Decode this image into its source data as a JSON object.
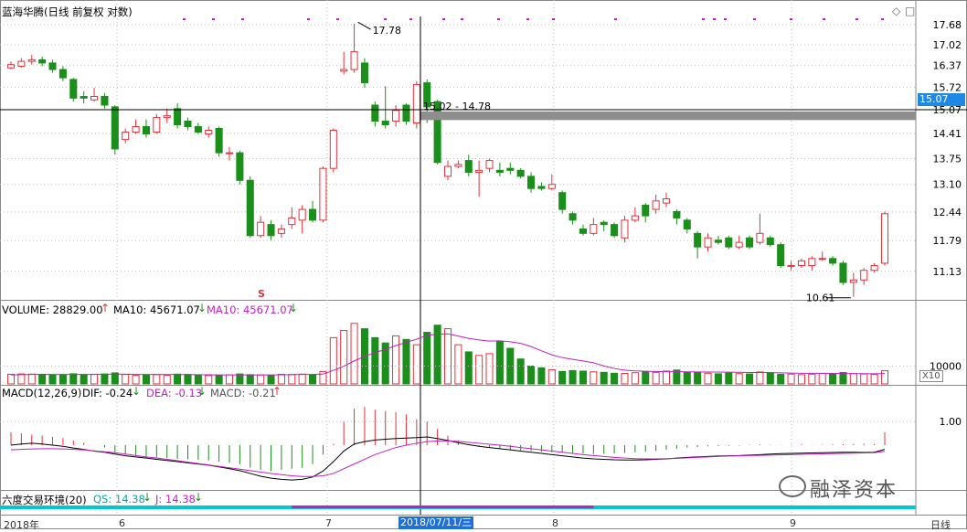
{
  "header": {
    "stock_title": "蓝海华腾(日线 前复权 对数)",
    "current_price": "15.07",
    "corner_icons": [
      "diamond-icon",
      "square-icon"
    ]
  },
  "colors": {
    "up": "#e8303a",
    "down": "#1a8f1a",
    "ma10": "#c020c0",
    "dif": "#000000",
    "dea": "#c020c0",
    "qs": "#00c8d0",
    "j": "#c020c0"
  },
  "annotations": {
    "high_label": "17.78",
    "low_label": "10.61",
    "box_label": "15.02 - 14.78",
    "marker": "S"
  },
  "volume": {
    "label": "VOLUME: 28829.00",
    "ma10_a": "MA10: 45671.07",
    "ma10_b": "MA10: 45671.07",
    "tick": "10000",
    "scale": "X10"
  },
  "macd": {
    "label": "MACD(12,26,9)",
    "dif": "DIF: -0.24",
    "dea": "DEA: -0.13",
    "macd": "MACD: -0.21",
    "tick": "1.00"
  },
  "env": {
    "label": "六度交易环境(20)",
    "qs": "QS: 14.38",
    "j": "J: 14.38"
  },
  "xaxis": {
    "year": "2018年",
    "months": [
      "6",
      "7",
      "8",
      "9"
    ],
    "crosshair_date": "2018/07/11/三",
    "period": "日线"
  },
  "watermark": "融泽资本",
  "chart_data": {
    "type": "candlestick",
    "title": "蓝海华腾(日线 前复权 对数)",
    "price_axis_ticks": [
      17.68,
      17.02,
      16.37,
      15.72,
      15.07,
      14.41,
      13.75,
      13.1,
      12.44,
      11.79,
      11.13
    ],
    "price_range": [
      10.55,
      17.95
    ],
    "candles": [
      {
        "o": 16.3,
        "c": 16.4,
        "h": 16.5,
        "l": 16.25
      },
      {
        "o": 16.35,
        "c": 16.5,
        "h": 16.6,
        "l": 16.3
      },
      {
        "o": 16.5,
        "c": 16.55,
        "h": 16.7,
        "l": 16.4
      },
      {
        "o": 16.55,
        "c": 16.45,
        "h": 16.65,
        "l": 16.35
      },
      {
        "o": 16.45,
        "c": 16.25,
        "h": 16.55,
        "l": 16.15
      },
      {
        "o": 16.25,
        "c": 16.0,
        "h": 16.35,
        "l": 15.9
      },
      {
        "o": 15.95,
        "c": 15.4,
        "h": 16.0,
        "l": 15.3
      },
      {
        "o": 15.45,
        "c": 15.4,
        "h": 15.6,
        "l": 15.25
      },
      {
        "o": 15.35,
        "c": 15.45,
        "h": 15.7,
        "l": 15.3
      },
      {
        "o": 15.45,
        "c": 15.2,
        "h": 15.55,
        "l": 15.1
      },
      {
        "o": 15.15,
        "c": 14.0,
        "h": 15.2,
        "l": 13.85
      },
      {
        "o": 14.25,
        "c": 14.45,
        "h": 14.55,
        "l": 14.15
      },
      {
        "o": 14.45,
        "c": 14.6,
        "h": 14.8,
        "l": 14.4
      },
      {
        "o": 14.6,
        "c": 14.4,
        "h": 14.8,
        "l": 14.3
      },
      {
        "o": 14.45,
        "c": 14.85,
        "h": 14.95,
        "l": 14.4
      },
      {
        "o": 14.85,
        "c": 14.9,
        "h": 15.1,
        "l": 14.7
      },
      {
        "o": 15.1,
        "c": 14.65,
        "h": 15.25,
        "l": 14.55
      },
      {
        "o": 14.75,
        "c": 14.6,
        "h": 14.85,
        "l": 14.5
      },
      {
        "o": 14.6,
        "c": 14.45,
        "h": 14.7,
        "l": 14.4
      },
      {
        "o": 14.4,
        "c": 14.5,
        "h": 14.6,
        "l": 14.3
      },
      {
        "o": 14.55,
        "c": 13.9,
        "h": 14.6,
        "l": 13.8
      },
      {
        "o": 13.9,
        "c": 13.9,
        "h": 14.05,
        "l": 13.7
      },
      {
        "o": 13.9,
        "c": 13.2,
        "h": 13.95,
        "l": 13.1
      },
      {
        "o": 13.2,
        "c": 11.9,
        "h": 13.3,
        "l": 11.85
      },
      {
        "o": 11.9,
        "c": 12.2,
        "h": 12.35,
        "l": 11.85
      },
      {
        "o": 12.15,
        "c": 11.9,
        "h": 12.25,
        "l": 11.8
      },
      {
        "o": 11.95,
        "c": 12.05,
        "h": 12.15,
        "l": 11.85
      },
      {
        "o": 12.15,
        "c": 12.3,
        "h": 12.55,
        "l": 12.05
      },
      {
        "o": 12.25,
        "c": 12.5,
        "h": 12.6,
        "l": 11.95
      },
      {
        "o": 12.5,
        "c": 12.25,
        "h": 12.7,
        "l": 12.2
      },
      {
        "o": 12.25,
        "c": 13.5,
        "h": 13.55,
        "l": 12.2
      },
      {
        "o": 13.5,
        "c": 14.5,
        "h": 14.55,
        "l": 13.4
      },
      {
        "o": 16.2,
        "c": 16.25,
        "h": 16.8,
        "l": 16.1
      },
      {
        "o": 16.25,
        "c": 16.8,
        "h": 17.7,
        "l": 16.15
      },
      {
        "o": 16.45,
        "c": 15.85,
        "h": 16.6,
        "l": 15.7
      },
      {
        "o": 15.2,
        "c": 14.75,
        "h": 15.3,
        "l": 14.6
      },
      {
        "o": 14.75,
        "c": 14.65,
        "h": 15.75,
        "l": 14.55
      },
      {
        "o": 14.75,
        "c": 15.05,
        "h": 15.2,
        "l": 14.6
      },
      {
        "o": 15.2,
        "c": 14.75,
        "h": 15.25,
        "l": 14.65
      },
      {
        "o": 14.7,
        "c": 15.8,
        "h": 15.9,
        "l": 14.55
      },
      {
        "o": 15.85,
        "c": 15.15,
        "h": 15.95,
        "l": 14.7
      },
      {
        "o": 15.3,
        "c": 13.65,
        "h": 15.35,
        "l": 13.6
      },
      {
        "o": 13.3,
        "c": 13.55,
        "h": 13.7,
        "l": 13.2
      },
      {
        "o": 13.55,
        "c": 13.6,
        "h": 13.7,
        "l": 13.5
      },
      {
        "o": 13.7,
        "c": 13.4,
        "h": 13.85,
        "l": 13.3
      },
      {
        "o": 13.4,
        "c": 13.45,
        "h": 13.7,
        "l": 12.8
      },
      {
        "o": 13.5,
        "c": 13.7,
        "h": 13.75,
        "l": 13.4
      },
      {
        "o": 13.45,
        "c": 13.4,
        "h": 13.65,
        "l": 13.3
      },
      {
        "o": 13.5,
        "c": 13.45,
        "h": 13.65,
        "l": 13.35
      },
      {
        "o": 13.45,
        "c": 13.3,
        "h": 13.5,
        "l": 13.25
      },
      {
        "o": 13.3,
        "c": 13.0,
        "h": 13.4,
        "l": 12.9
      },
      {
        "o": 13.05,
        "c": 13.0,
        "h": 13.15,
        "l": 12.95
      },
      {
        "o": 13.0,
        "c": 13.1,
        "h": 13.35,
        "l": 12.95
      },
      {
        "o": 12.9,
        "c": 12.5,
        "h": 12.95,
        "l": 12.4
      },
      {
        "o": 12.4,
        "c": 12.25,
        "h": 12.45,
        "l": 12.15
      },
      {
        "o": 12.05,
        "c": 11.95,
        "h": 12.15,
        "l": 11.9
      },
      {
        "o": 11.95,
        "c": 12.15,
        "h": 12.3,
        "l": 11.9
      },
      {
        "o": 12.2,
        "c": 12.15,
        "h": 12.25,
        "l": 12.0
      },
      {
        "o": 12.15,
        "c": 11.9,
        "h": 12.2,
        "l": 11.85
      },
      {
        "o": 11.85,
        "c": 12.25,
        "h": 12.35,
        "l": 11.75
      },
      {
        "o": 12.25,
        "c": 12.35,
        "h": 12.55,
        "l": 12.2
      },
      {
        "o": 12.6,
        "c": 12.35,
        "h": 12.65,
        "l": 12.2
      },
      {
        "o": 12.5,
        "c": 12.7,
        "h": 12.85,
        "l": 12.4
      },
      {
        "o": 12.65,
        "c": 12.75,
        "h": 12.9,
        "l": 12.55
      },
      {
        "o": 12.45,
        "c": 12.3,
        "h": 12.5,
        "l": 12.15
      },
      {
        "o": 12.25,
        "c": 12.05,
        "h": 12.3,
        "l": 11.95
      },
      {
        "o": 11.95,
        "c": 11.65,
        "h": 12.0,
        "l": 11.4
      },
      {
        "o": 11.65,
        "c": 11.85,
        "h": 11.95,
        "l": 11.55
      },
      {
        "o": 11.8,
        "c": 11.75,
        "h": 11.9,
        "l": 11.7
      },
      {
        "o": 11.85,
        "c": 11.65,
        "h": 11.9,
        "l": 11.6
      },
      {
        "o": 11.65,
        "c": 11.75,
        "h": 11.9,
        "l": 11.6
      },
      {
        "o": 11.85,
        "c": 11.65,
        "h": 11.9,
        "l": 11.6
      },
      {
        "o": 11.75,
        "c": 11.95,
        "h": 12.4,
        "l": 11.7
      },
      {
        "o": 11.85,
        "c": 11.7,
        "h": 11.9,
        "l": 11.65
      },
      {
        "o": 11.7,
        "c": 11.25,
        "h": 11.75,
        "l": 11.2
      },
      {
        "o": 11.25,
        "c": 11.25,
        "h": 11.35,
        "l": 11.15
      },
      {
        "o": 11.25,
        "c": 11.35,
        "h": 11.4,
        "l": 11.2
      },
      {
        "o": 11.25,
        "c": 11.4,
        "h": 11.45,
        "l": 11.15
      },
      {
        "o": 11.4,
        "c": 11.4,
        "h": 11.55,
        "l": 11.35
      },
      {
        "o": 11.4,
        "c": 11.3,
        "h": 11.45,
        "l": 11.25
      },
      {
        "o": 11.3,
        "c": 10.9,
        "h": 11.35,
        "l": 10.85
      },
      {
        "o": 10.9,
        "c": 10.95,
        "h": 11.1,
        "l": 10.61
      },
      {
        "o": 10.95,
        "c": 11.15,
        "h": 11.2,
        "l": 10.85
      },
      {
        "o": 11.15,
        "c": 11.25,
        "h": 11.3,
        "l": 11.1
      },
      {
        "o": 11.3,
        "c": 12.4,
        "h": 12.45,
        "l": 11.25
      }
    ],
    "volume": [
      5400,
      5600,
      5500,
      5300,
      5000,
      5100,
      5700,
      5200,
      5400,
      5600,
      6200,
      5300,
      4800,
      5000,
      5200,
      4900,
      5500,
      5300,
      5000,
      4700,
      4800,
      5100,
      5600,
      5200,
      5000,
      4900,
      5400,
      5300,
      5500,
      5000,
      7000,
      26000,
      30000,
      34000,
      31000,
      26000,
      23000,
      27000,
      25000,
      22000,
      29000,
      33000,
      31000,
      22000,
      18000,
      16000,
      17000,
      24000,
      20000,
      14000,
      10000,
      9000,
      8000,
      7000,
      7500,
      7200,
      6800,
      6500,
      6000,
      5900,
      6300,
      6700,
      6500,
      7200,
      7800,
      6600,
      6400,
      6000,
      5700,
      6100,
      5800,
      5600,
      6700,
      6300,
      5400,
      5500,
      5200,
      5500,
      5900,
      5700,
      6400,
      5800,
      5600,
      5300,
      7400
    ],
    "ma10": [
      5100,
      5200,
      5300,
      5400,
      5350,
      5300,
      5350,
      5300,
      5350,
      5400,
      5500,
      5450,
      5350,
      5300,
      5300,
      5250,
      5300,
      5250,
      5200,
      5150,
      5100,
      5050,
      5050,
      5100,
      5100,
      5100,
      5150,
      5200,
      5300,
      5300,
      5500,
      7600,
      10000,
      12900,
      15500,
      17600,
      19400,
      21500,
      23400,
      25100,
      27300,
      28000,
      28100,
      26900,
      25600,
      24700,
      24100,
      24200,
      23700,
      22800,
      21000,
      18600,
      16300,
      14800,
      13800,
      12900,
      11900,
      10100,
      8700,
      7700,
      7300,
      7100,
      7000,
      6900,
      6900,
      6800,
      6750,
      6700,
      6650,
      6600,
      6550,
      6450,
      6400,
      6350,
      6200,
      6100,
      6000,
      5950,
      5950,
      5900,
      5850,
      5800,
      5750,
      5700,
      5850
    ],
    "macd_hist": [
      0.55,
      0.5,
      0.45,
      0.4,
      0.35,
      0.3,
      0.2,
      0.1,
      0.0,
      -0.1,
      -0.3,
      -0.4,
      -0.45,
      -0.5,
      -0.52,
      -0.55,
      -0.58,
      -0.6,
      -0.62,
      -0.65,
      -0.7,
      -0.75,
      -0.8,
      -0.95,
      -1.05,
      -1.1,
      -1.05,
      -1.0,
      -0.95,
      -0.8,
      -0.4,
      0.05,
      1.0,
      1.55,
      1.62,
      1.5,
      1.45,
      1.4,
      1.3,
      1.1,
      1.0,
      0.7,
      0.4,
      0.2,
      0.05,
      -0.05,
      -0.1,
      -0.15,
      -0.2,
      -0.22,
      -0.25,
      -0.28,
      -0.3,
      -0.32,
      -0.35,
      -0.36,
      -0.38,
      -0.37,
      -0.35,
      -0.33,
      -0.3,
      -0.28,
      -0.25,
      -0.2,
      -0.15,
      -0.1,
      -0.08,
      -0.05,
      -0.04,
      -0.03,
      -0.02,
      0.02,
      0.03,
      0.02,
      0.01,
      0.02,
      0.03,
      0.01,
      0.02,
      0.03,
      0.04,
      0.05,
      0.06,
      0.05,
      0.55
    ],
    "dif": [
      0.0,
      0.05,
      0.08,
      0.05,
      0.0,
      -0.05,
      -0.12,
      -0.18,
      -0.25,
      -0.3,
      -0.38,
      -0.45,
      -0.5,
      -0.55,
      -0.6,
      -0.65,
      -0.7,
      -0.75,
      -0.8,
      -0.85,
      -0.92,
      -1.0,
      -1.08,
      -1.2,
      -1.32,
      -1.4,
      -1.45,
      -1.48,
      -1.45,
      -1.35,
      -1.1,
      -0.7,
      -0.25,
      0.05,
      0.15,
      0.22,
      0.25,
      0.28,
      0.3,
      0.32,
      0.35,
      0.28,
      0.2,
      0.1,
      0.02,
      -0.05,
      -0.1,
      -0.15,
      -0.2,
      -0.25,
      -0.3,
      -0.35,
      -0.4,
      -0.45,
      -0.5,
      -0.55,
      -0.58,
      -0.6,
      -0.62,
      -0.63,
      -0.63,
      -0.62,
      -0.6,
      -0.58,
      -0.55,
      -0.52,
      -0.5,
      -0.48,
      -0.46,
      -0.45,
      -0.44,
      -0.42,
      -0.4,
      -0.38,
      -0.36,
      -0.35,
      -0.34,
      -0.33,
      -0.32,
      -0.31,
      -0.3,
      -0.3,
      -0.31,
      -0.3,
      -0.18
    ],
    "dea": [
      -0.2,
      -0.18,
      -0.16,
      -0.15,
      -0.15,
      -0.16,
      -0.18,
      -0.2,
      -0.24,
      -0.28,
      -0.32,
      -0.38,
      -0.44,
      -0.5,
      -0.55,
      -0.6,
      -0.66,
      -0.72,
      -0.78,
      -0.84,
      -0.9,
      -0.96,
      -1.02,
      -1.08,
      -1.14,
      -1.2,
      -1.25,
      -1.3,
      -1.33,
      -1.33,
      -1.3,
      -1.2,
      -1.0,
      -0.8,
      -0.6,
      -0.4,
      -0.25,
      -0.1,
      0.0,
      0.08,
      0.15,
      0.18,
      0.18,
      0.16,
      0.12,
      0.08,
      0.04,
      0.0,
      -0.05,
      -0.1,
      -0.15,
      -0.2,
      -0.25,
      -0.3,
      -0.35,
      -0.4,
      -0.44,
      -0.48,
      -0.52,
      -0.55,
      -0.57,
      -0.58,
      -0.58,
      -0.57,
      -0.56,
      -0.54,
      -0.52,
      -0.5,
      -0.48,
      -0.46,
      -0.45,
      -0.44,
      -0.43,
      -0.42,
      -0.41,
      -0.4,
      -0.39,
      -0.38,
      -0.37,
      -0.36,
      -0.35,
      -0.34,
      -0.33,
      -0.32,
      -0.26
    ],
    "macd_range": [
      -1.9,
      1.9
    ]
  }
}
